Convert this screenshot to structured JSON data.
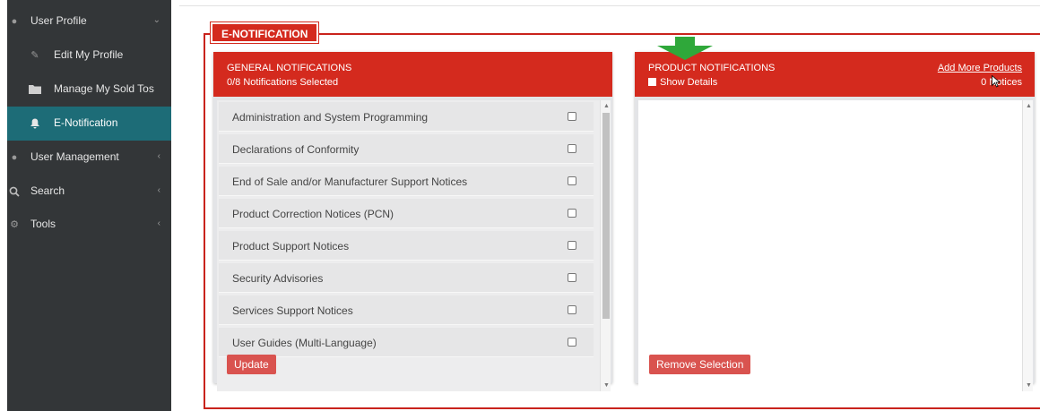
{
  "sidebar": {
    "items": [
      {
        "label": "User Profile",
        "icon": "user-icon",
        "chevron": "⌄"
      },
      {
        "label": "Edit My Profile",
        "icon": "edit-icon"
      },
      {
        "label": "Manage My Sold Tos",
        "icon": "folder-icon"
      },
      {
        "label": "E-Notification",
        "icon": "bell-icon"
      },
      {
        "label": "User Management",
        "icon": "users-icon",
        "chevron": "‹"
      },
      {
        "label": "Search",
        "icon": "search-icon",
        "chevron": "‹"
      },
      {
        "label": "Tools",
        "icon": "gear-icon",
        "chevron": "‹"
      }
    ]
  },
  "section": {
    "legend": "E-NOTIFICATION"
  },
  "general": {
    "title": "GENERAL NOTIFICATIONS",
    "subtitle": "0/8 Notifications Selected",
    "rows": [
      "Administration and System Programming",
      "Declarations of Conformity",
      "End of Sale and/or Manufacturer Support Notices",
      "Product Correction Notices (PCN)",
      "Product Support Notices",
      "Security Advisories",
      "Services Support Notices",
      "User Guides (Multi-Language)"
    ],
    "update_label": "Update"
  },
  "product": {
    "title": "PRODUCT NOTIFICATIONS",
    "show_details": "Show Details",
    "add_more": "Add More Products",
    "count": "0  Notices",
    "remove_label": "Remove Selection"
  },
  "colors": {
    "brand_red": "#d42a1e",
    "sidebar_bg": "#333638",
    "active_teal": "#1d6c77",
    "arrow_green": "#2fa83a"
  }
}
